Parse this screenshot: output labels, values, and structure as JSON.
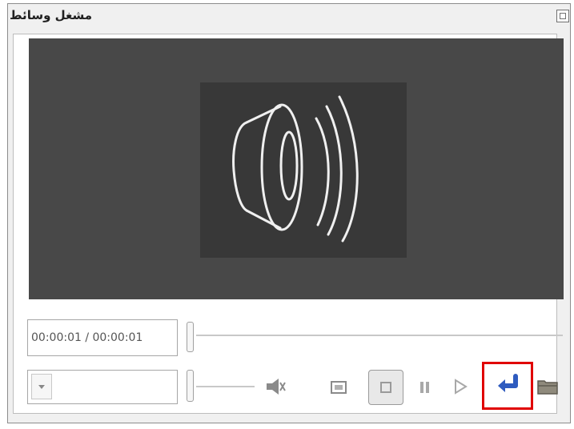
{
  "window": {
    "title": "مشغل وسائط"
  },
  "player": {
    "time_display": "00:00:01 / 00:00:01",
    "volume_icon": "speaker-mute-icon",
    "controls": {
      "fullscreen": "fullscreen-icon",
      "stop": "stop-icon",
      "pause": "pause-icon",
      "play": "play-icon",
      "return": "return-arrow-icon",
      "open": "folder-open-icon"
    }
  },
  "colors": {
    "video_bg": "#484848",
    "highlight": "#e00000",
    "return_icon": "#2e5bbf"
  }
}
